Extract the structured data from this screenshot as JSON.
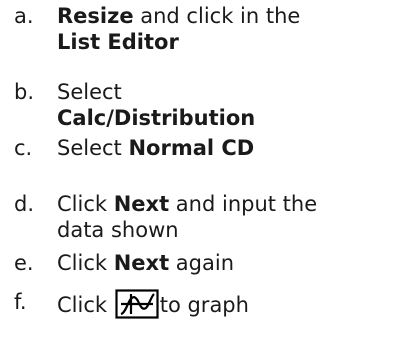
{
  "steps": [
    {
      "letter": "a.",
      "t1": "Resize",
      "t2": " and click in the",
      "t3": "List Editor"
    },
    {
      "letter": "b.",
      "t1": "Select",
      "t2": "Calc/Distribution"
    },
    {
      "letter": "c.",
      "t1": "Select ",
      "t2": "Normal CD"
    },
    {
      "letter": "d.",
      "t1": "Click ",
      "t2": "Next",
      "t3": " and input the",
      "t4": "data shown"
    },
    {
      "letter": "e.",
      "t1": "Click ",
      "t2": "Next",
      "t3": " again"
    },
    {
      "letter": "f.",
      "t1": "Click ",
      "icon": "graph-icon",
      "t2": "to graph"
    }
  ],
  "icon_color": "#000000"
}
